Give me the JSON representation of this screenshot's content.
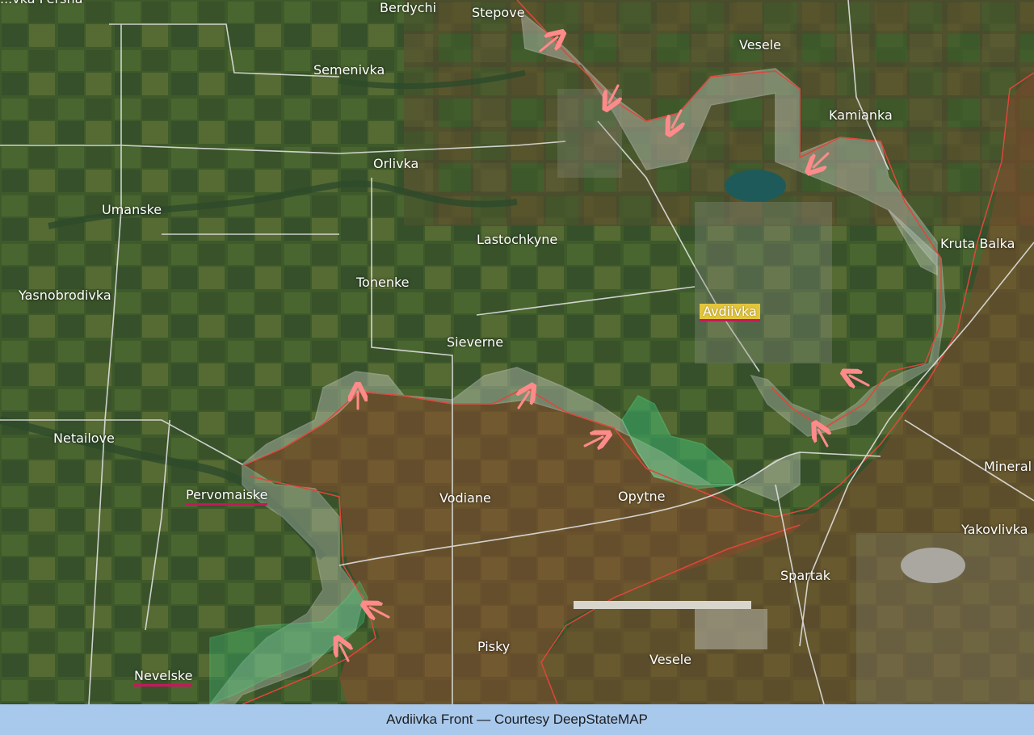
{
  "map": {
    "colors": {
      "occupied": "#b0543b",
      "contested": "#c9d1c9",
      "liberated": "#3fc57a",
      "front_line": "#e0463a",
      "arrow": "#ff8a8a",
      "road": "#e8e8e8",
      "label_underline": "#c8175d",
      "label_highlight": "#e3c53c"
    },
    "labels": {
      "persha": "...vka Persha",
      "berdychi": "Berdychi",
      "stepove": "Stepove",
      "vesele_n": "Vesele",
      "semenivka": "Semenivka",
      "kamianka": "Kamianka",
      "orlivka": "Orlivka",
      "umanske": "Umanske",
      "lastochkyne": "Lastochkyne",
      "kruta_balka": "Kruta Balka",
      "tonenke": "Tonenke",
      "yasnobrodivka": "Yasnobrodivka",
      "avdiivka": "Avdiivka",
      "sieverne": "Sieverne",
      "netailove": "Netailove",
      "mineral": "Mineral",
      "pervomaiske": "Pervomaiske",
      "vodiane": "Vodiane",
      "opytne": "Opytne",
      "yakovlivka": "Yakovlivka",
      "spartak": "Spartak",
      "pisky": "Pisky",
      "vesele_s": "Vesele",
      "nevelske": "Nevelske"
    }
  },
  "caption": "Avdiivka Front — Courtesy DeepStateMAP"
}
